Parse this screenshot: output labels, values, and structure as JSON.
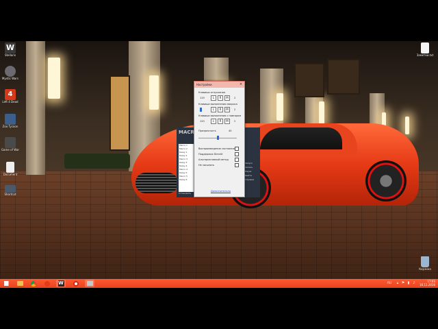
{
  "desktop": {
    "icons": [
      {
        "label": "Stellaris",
        "icon": "stellaris-icon",
        "color": "#3a3a3a"
      },
      {
        "label": "Mystic Wars",
        "icon": "game-shield-icon",
        "color": "#6a6a70"
      },
      {
        "label": "Left 4 Dead",
        "icon": "left4dead-icon",
        "color": "#d43a1a"
      },
      {
        "label": "Zoo Tycoon",
        "icon": "game-icon",
        "color": "#3b5f8a"
      },
      {
        "label": "Game of War",
        "icon": "sword-icon",
        "color": "#4a4a4a"
      },
      {
        "label": "Document",
        "icon": "file-icon",
        "color": "#eeeeee"
      },
      {
        "label": "Shortcut",
        "icon": "monitor-icon",
        "color": "#4a5a6a"
      },
      {
        "label": "Заметки.txt",
        "icon": "text-file-icon",
        "color": "#f5f5f5"
      },
      {
        "label": "Корзина",
        "icon": "recycle-bin-icon",
        "color": "#9ab6d0"
      }
    ]
  },
  "dialog": {
    "title": "Настройки",
    "close": "×",
    "sections": [
      {
        "label": "Клавиша отпускания",
        "value": "119",
        "buttons": [
          "L",
          "R",
          "M"
        ],
        "extra": "2"
      },
      {
        "label": "Клавиша выполнения макроса",
        "value": "",
        "buttons": [
          "L",
          "R",
          "M"
        ],
        "extra": "2"
      },
      {
        "label": "Клавиша выполнения с повтором",
        "value": "120",
        "buttons": [
          "L",
          "R",
          "M"
        ],
        "extra": "2"
      }
    ],
    "transparency_label": "Прозрачность",
    "transparency_value": "40",
    "checkboxes": [
      "Воспроизведение состояния",
      "Поддержка DirectX",
      "Альтернативный метод",
      "Не засыпать"
    ],
    "link": "Дополнительно"
  },
  "backpanel": {
    "title": "MACRO",
    "list": [
      "Macro 1",
      "Macro 2",
      "Delay 1",
      "Delay 2",
      "Macro 3",
      "Delay 3",
      "Delay 4",
      "Macro 4",
      "Delay 5",
      "Macro 5",
      "Delay 6"
    ],
    "side_text": [
      "Запуск",
      "Запись",
      "Пауза",
      "Выйти",
      "Справка"
    ],
    "button": "Установить"
  },
  "taskbar": {
    "lang": "RU",
    "time": "17:03",
    "date": "16.11.2016",
    "apps": [
      {
        "name": "start",
        "icon": "windows-logo-icon",
        "color": "#ffffff"
      },
      {
        "name": "explorer",
        "icon": "folder-icon",
        "color": "#f0c050"
      },
      {
        "name": "chrome",
        "icon": "chrome-icon",
        "color": "#4caf50"
      },
      {
        "name": "yandex",
        "icon": "browser-icon",
        "color": "#e23a1a"
      },
      {
        "name": "stellaris",
        "icon": "stellaris-icon",
        "color": "#2a2a2a"
      },
      {
        "name": "opera",
        "icon": "opera-icon",
        "color": "#d8261a"
      },
      {
        "name": "app",
        "icon": "window-icon",
        "color": "#c8c8c8"
      }
    ]
  }
}
